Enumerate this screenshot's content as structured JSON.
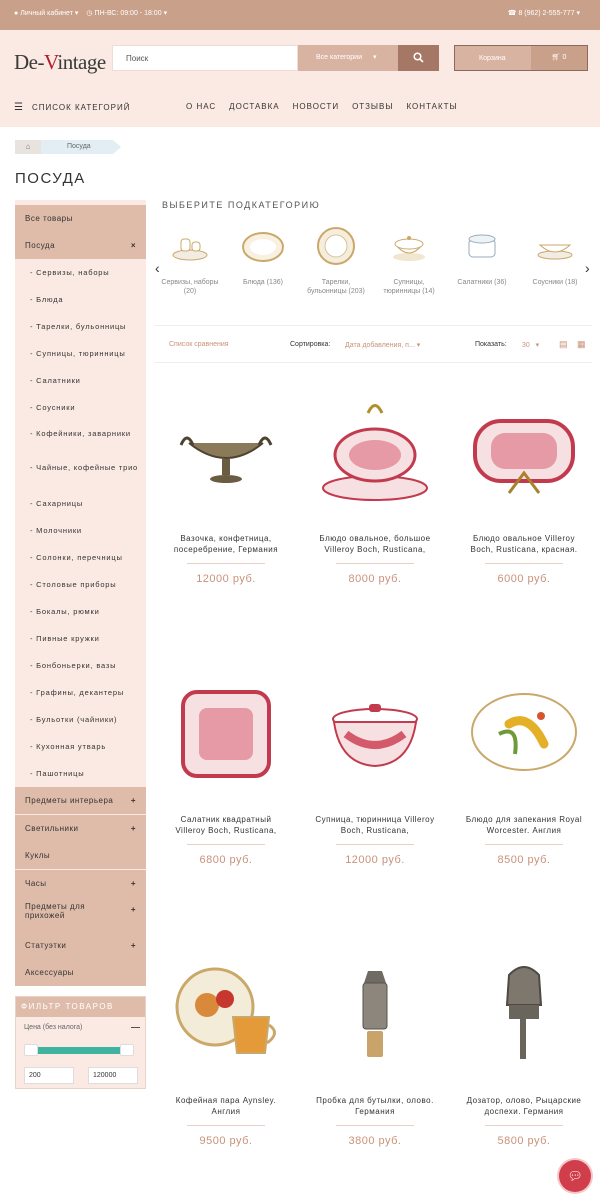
{
  "topbar": {
    "account": "Личный кабинет",
    "hours": "ПН-ВС: 09:00 - 18:00",
    "phone": "8 (962) 2-555-777"
  },
  "header": {
    "logo_a": "De-",
    "logo_v": "V",
    "logo_b": "intage",
    "search_placeholder": "Поиск",
    "all_categories": "Все категории",
    "cart_label": "Корзина",
    "cart_count": "0",
    "category_menu": "СПИСОК КАТЕГОРИЙ",
    "nav": [
      "О НАС",
      "ДОСТАВКА",
      "НОВОСТИ",
      "ОТЗЫВЫ",
      "КОНТАКТЫ"
    ]
  },
  "breadcrumb": {
    "current": "Посуда"
  },
  "page_title": "ПОСУДА",
  "sidebar": {
    "main_top": [
      {
        "label": "Все товары",
        "mark": ""
      },
      {
        "label": "Посуда",
        "mark": "×"
      }
    ],
    "subs": [
      "- Сервизы, наборы",
      "- Блюда",
      "- Тарелки, бульонницы",
      "- Супницы, тюринницы",
      "- Салатники",
      "- Соусники",
      "- Кофейники, заварники",
      "- Чайные, кофейные трио",
      "- Сахарницы",
      "- Молочники",
      "- Солонки, перечницы",
      "- Столовые приборы",
      "- Бокалы, рюмки",
      "- Пивные кружки",
      "- Бонбоньерки, вазы",
      "- Графины, декантеры",
      "- Бульотки (чайники)",
      "- Кухонная утварь",
      "- Пашотницы"
    ],
    "main_bottom": [
      {
        "label": "Предметы интерьера",
        "mark": "+"
      },
      {
        "label": "Светильники",
        "mark": "+"
      },
      {
        "label": "Куклы",
        "mark": ""
      },
      {
        "label": "Часы",
        "mark": "+"
      },
      {
        "label": "Предметы для прихожей",
        "mark": "+"
      },
      {
        "label": "Статуэтки",
        "mark": "+"
      },
      {
        "label": "Аксессуары",
        "mark": ""
      }
    ]
  },
  "filter": {
    "title": "ФИЛЬТР ТОВАРОВ",
    "price_label": "Цена (без налога)",
    "min": "200",
    "max": "120000"
  },
  "subcategories": {
    "title": "ВЫБЕРИТЕ ПОДКАТЕГОРИЮ",
    "items": [
      "Сервизы, наборы (20)",
      "Блюда (136)",
      "Тарелки, бульонницы (203)",
      "Супницы, тюринницы (14)",
      "Салатники (36)",
      "Соусники (18)"
    ]
  },
  "toolbar": {
    "compare": "Список сравнения",
    "sort_label": "Сортировка:",
    "sort_value": "Дата добавления, п...",
    "show_label": "Показать:",
    "show_value": "30"
  },
  "products": [
    {
      "name": "Вазочка, конфетница, посеребрение, Германия",
      "price": "12000 руб."
    },
    {
      "name": "Блюдо овальное, большое Villeroy Boch, Rusticana,",
      "price": "8000 руб."
    },
    {
      "name": "Блюдо овальное Villeroy Boch, Rusticana, красная.",
      "price": "6000 руб."
    },
    {
      "name": "Салатник квадратный Villeroy Boch, Rusticana,",
      "price": "6800 руб."
    },
    {
      "name": "Супница, тюринница Villeroy Boch, Rusticana,",
      "price": "12000 руб."
    },
    {
      "name": "Блюдо для запекания Royal Worcester. Англия",
      "price": "8500 руб."
    },
    {
      "name": "Кофейная пара Aynsley. Англия",
      "price": "9500 руб."
    },
    {
      "name": "Пробка для бутылки, олово. Германия",
      "price": "3800 руб."
    },
    {
      "name": "Дозатор, олово, Рыцарские доспехи. Германия",
      "price": "5800 руб."
    }
  ],
  "colors": {
    "accent": "#c9a08a",
    "header_bg": "#fbeae3",
    "price": "#c9927a",
    "chat": "#d13e4b"
  }
}
